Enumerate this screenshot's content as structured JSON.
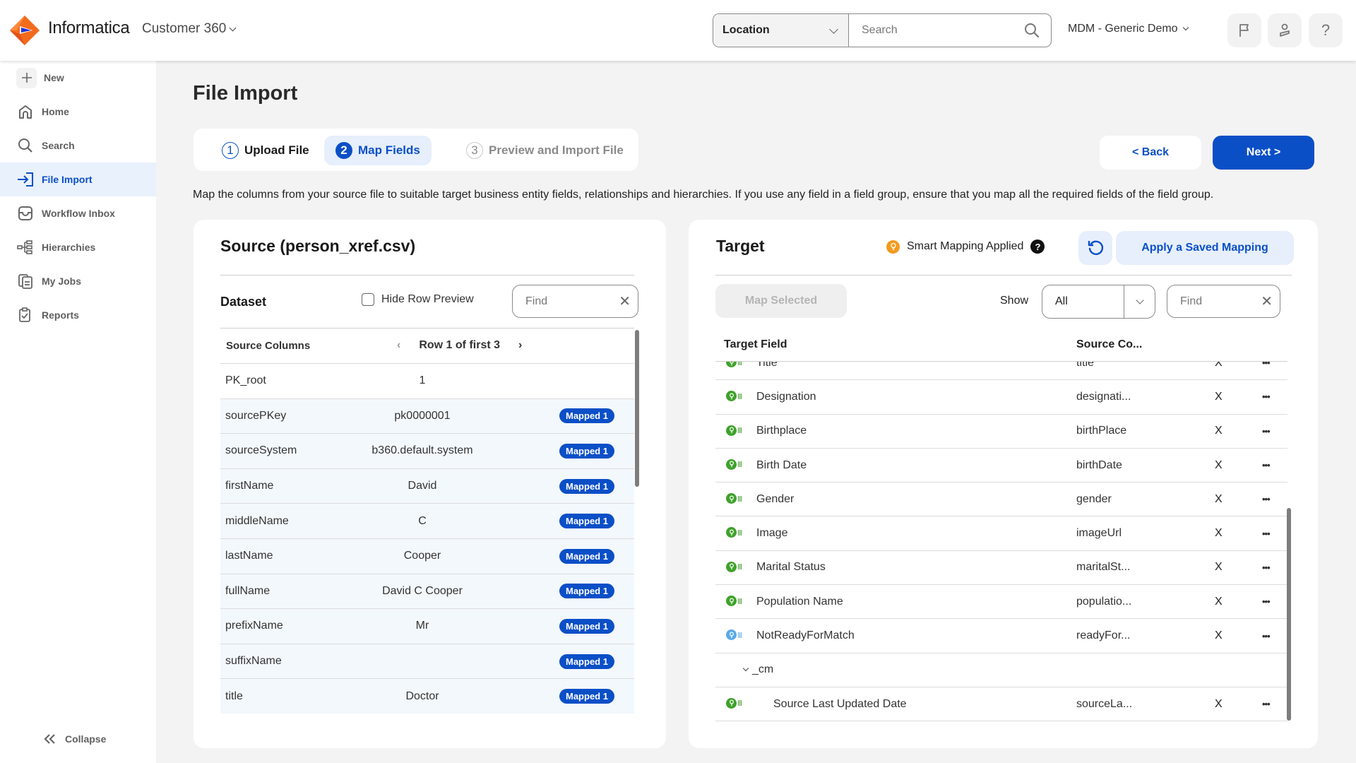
{
  "header": {
    "brand": "Informatica",
    "product": "Customer 360",
    "location_select": "Location",
    "search_placeholder": "Search",
    "org": "MDM - Generic Demo",
    "icons": [
      "flag-icon",
      "user-icon",
      "help-icon"
    ],
    "help_glyph": "?"
  },
  "sidebar": {
    "items": [
      {
        "label": "New",
        "icon": "plus-icon"
      },
      {
        "label": "Home",
        "icon": "home-icon"
      },
      {
        "label": "Search",
        "icon": "search-icon"
      },
      {
        "label": "File Import",
        "icon": "file-import-icon",
        "active": true
      },
      {
        "label": "Workflow Inbox",
        "icon": "inbox-icon"
      },
      {
        "label": "Hierarchies",
        "icon": "hierarchy-icon"
      },
      {
        "label": "My Jobs",
        "icon": "jobs-icon"
      },
      {
        "label": "Reports",
        "icon": "reports-icon"
      }
    ],
    "collapse": "Collapse"
  },
  "page": {
    "title": "File Import",
    "steps": [
      {
        "num": "1",
        "label": "Upload File",
        "state": "done"
      },
      {
        "num": "2",
        "label": "Map Fields",
        "state": "active"
      },
      {
        "num": "3",
        "label": "Preview and Import File",
        "state": "pending"
      }
    ],
    "back": "< Back",
    "next": "Next >",
    "description": "Map the columns from your source file to suitable target business entity fields, relationships and hierarchies. If you use any field in a field group, ensure that you map all the required fields of the field group."
  },
  "source": {
    "title": "Source (person_xref.csv)",
    "dataset_label": "Dataset",
    "hide_row_preview": "Hide Row Preview",
    "hide_row_preview_checked": false,
    "find_placeholder": "Find",
    "col_header": "Source Columns",
    "row_nav": "Row 1 of first 3",
    "rows": [
      {
        "column": "PK_root",
        "value": "1",
        "badge": ""
      },
      {
        "column": "sourcePKey",
        "value": "pk0000001",
        "badge": "Mapped 1"
      },
      {
        "column": "sourceSystem",
        "value": "b360.default.system",
        "badge": "Mapped 1"
      },
      {
        "column": "firstName",
        "value": "David",
        "badge": "Mapped 1"
      },
      {
        "column": "middleName",
        "value": "C",
        "badge": "Mapped 1"
      },
      {
        "column": "lastName",
        "value": "Cooper",
        "badge": "Mapped 1"
      },
      {
        "column": "fullName",
        "value": "David C Cooper",
        "badge": "Mapped 1"
      },
      {
        "column": "prefixName",
        "value": "Mr",
        "badge": "Mapped 1"
      },
      {
        "column": "suffixName",
        "value": "",
        "badge": "Mapped 1"
      },
      {
        "column": "title",
        "value": "Doctor",
        "badge": "Mapped 1"
      }
    ]
  },
  "target": {
    "title": "Target",
    "smart_mapping": "Smart Mapping Applied",
    "help": "?",
    "apply_saved": "Apply a Saved Mapping",
    "map_selected": "Map Selected",
    "show_label": "Show",
    "show_value": "All",
    "find_placeholder": "Find",
    "col_target": "Target Field",
    "col_source": "Source Co...",
    "remove_glyph": "X",
    "more_glyph": "•••",
    "rows": [
      {
        "field": "Title",
        "source": "title",
        "status": "mapped"
      },
      {
        "field": "Designation",
        "source": "designati...",
        "status": "mapped"
      },
      {
        "field": "Birthplace",
        "source": "birthPlace",
        "status": "mapped"
      },
      {
        "field": "Birth Date",
        "source": "birthDate",
        "status": "mapped"
      },
      {
        "field": "Gender",
        "source": "gender",
        "status": "mapped"
      },
      {
        "field": "Image",
        "source": "imageUrl",
        "status": "mapped"
      },
      {
        "field": "Marital Status",
        "source": "maritalSt...",
        "status": "mapped"
      },
      {
        "field": "Population Name",
        "source": "populatio...",
        "status": "mapped"
      },
      {
        "field": "NotReadyForMatch",
        "source": "readyFor...",
        "status": "suggested"
      }
    ],
    "group": {
      "label": "_cm",
      "rows": [
        {
          "field": "Source Last Updated Date",
          "source": "sourceLa...",
          "status": "mapped"
        }
      ]
    }
  },
  "colors": {
    "brand_blue": "#0b4fc7",
    "mapped_green": "#3fa12b",
    "suggested_blue": "#5aa9ea",
    "smart_orange": "#f39a1e"
  }
}
